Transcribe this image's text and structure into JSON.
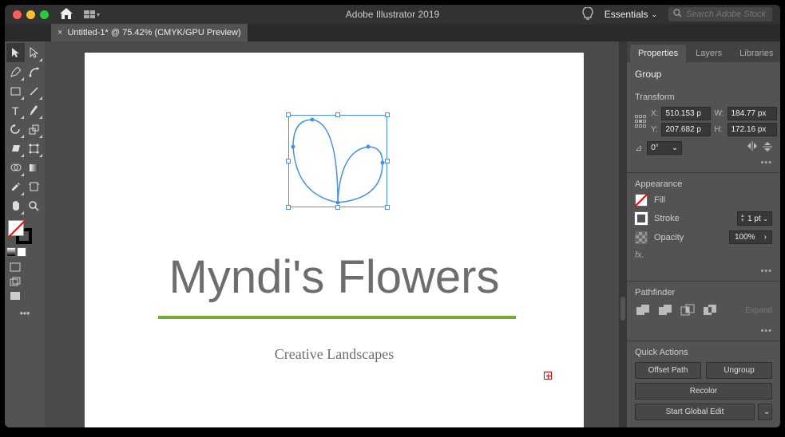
{
  "titlebar": {
    "app_title": "Adobe Illustrator 2019",
    "workspace": "Essentials",
    "search_placeholder": "Search Adobe Stock"
  },
  "doctab": {
    "title": "Untitled-1* @ 75.42% (CMYK/GPU Preview)"
  },
  "artwork": {
    "headline": "Myndi's Flowers",
    "tagline": "Creative Landscapes"
  },
  "panel_tabs": {
    "properties": "Properties",
    "layers": "Layers",
    "libraries": "Libraries"
  },
  "selection_type": "Group",
  "transform": {
    "title": "Transform",
    "x_label": "X:",
    "x_value": "510.153 p",
    "y_label": "Y:",
    "y_value": "207.682 p",
    "w_label": "W:",
    "w_value": "184.77 px",
    "h_label": "H:",
    "h_value": "172.16 px",
    "angle_value": "0°"
  },
  "appearance": {
    "title": "Appearance",
    "fill_label": "Fill",
    "stroke_label": "Stroke",
    "stroke_value": "1 pt",
    "opacity_label": "Opacity",
    "opacity_value": "100%",
    "fx_label": "fx."
  },
  "pathfinder": {
    "title": "Pathfinder",
    "expand": "Expand"
  },
  "quick_actions": {
    "title": "Quick Actions",
    "offset_path": "Offset Path",
    "ungroup": "Ungroup",
    "recolor": "Recolor",
    "start_global_edit": "Start Global Edit"
  }
}
